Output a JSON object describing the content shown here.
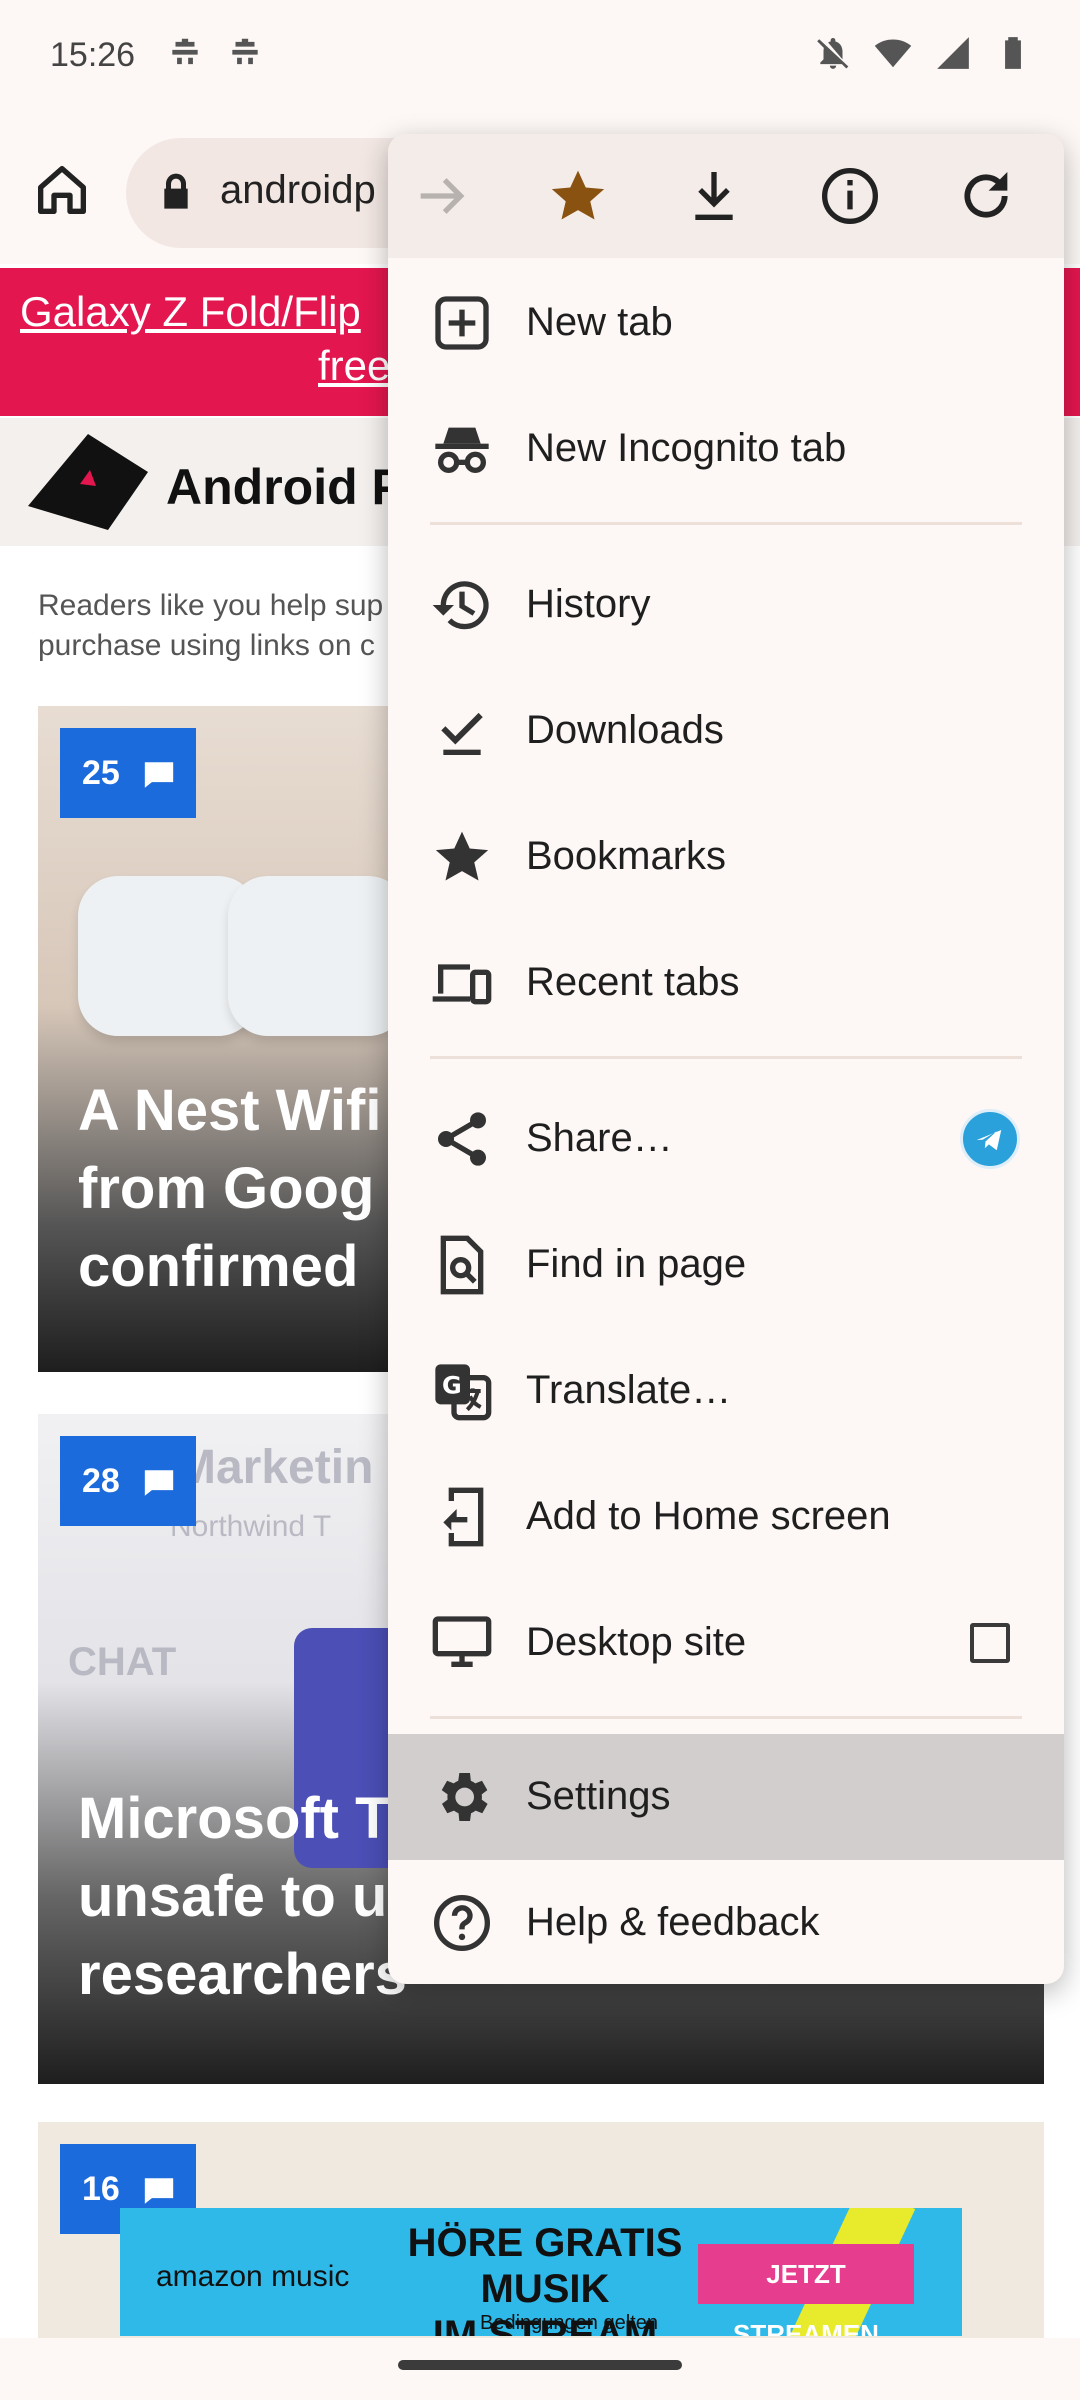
{
  "status_bar": {
    "time": "15:26",
    "left_icons": [
      "game-controller-icon",
      "game-controller-icon"
    ],
    "right_icons": [
      "bell-off-icon",
      "wifi-icon",
      "cell-signal-icon",
      "battery-icon"
    ]
  },
  "toolbar": {
    "home_icon": "home-icon",
    "lock_icon": "lock-icon",
    "url_text": "androidp"
  },
  "page": {
    "promo_line1": "Galaxy Z Fold/Flip",
    "promo_line2": "free",
    "site_name": "Android P",
    "disclaimer_line1": "Readers like you help sup",
    "disclaimer_line2": "purchase using links on c",
    "articles": [
      {
        "comments": "25",
        "title_lines": [
          "A Nest Wifi",
          "from Goog",
          "confirmed"
        ]
      },
      {
        "comments": "28",
        "title_lines": [
          "Microsoft T",
          "unsafe to u",
          "researchers"
        ],
        "bg_text": [
          "Marketin",
          "Northwind T",
          "CHAT"
        ]
      },
      {
        "comments": "16"
      }
    ],
    "ad": {
      "brand": "amazon music",
      "headline_line1": "HÖRE GRATIS MUSIK",
      "headline_line2": "IM STREAM",
      "subtext": "Bedingungen gelten",
      "cta": "JETZT STREAMEN"
    }
  },
  "menu": {
    "top_actions": [
      "forward-icon",
      "bookmark-star-icon",
      "download-icon",
      "info-icon",
      "reload-icon"
    ],
    "items": [
      {
        "label": "New tab",
        "icon": "new-tab-icon"
      },
      {
        "label": "New Incognito tab",
        "icon": "incognito-icon"
      },
      {
        "label": "History",
        "icon": "history-icon"
      },
      {
        "label": "Downloads",
        "icon": "downloads-icon"
      },
      {
        "label": "Bookmarks",
        "icon": "star-icon"
      },
      {
        "label": "Recent tabs",
        "icon": "devices-icon"
      },
      {
        "label": "Share…",
        "icon": "share-icon",
        "accessory": "telegram-icon"
      },
      {
        "label": "Find in page",
        "icon": "find-in-page-icon"
      },
      {
        "label": "Translate…",
        "icon": "translate-icon"
      },
      {
        "label": "Add to Home screen",
        "icon": "add-to-home-icon"
      },
      {
        "label": "Desktop site",
        "icon": "desktop-icon",
        "checked": false
      },
      {
        "label": "Settings",
        "icon": "gear-icon",
        "selected": true
      },
      {
        "label": "Help & feedback",
        "icon": "help-icon"
      }
    ]
  },
  "colors": {
    "menu_bg": "#fdf8f6",
    "menu_top_bg": "#f3ece8",
    "selected_row": "#d2cece",
    "bookmark_star": "#8a5210",
    "promo_bg": "#e3164f",
    "comment_badge": "#1c6bdc"
  }
}
